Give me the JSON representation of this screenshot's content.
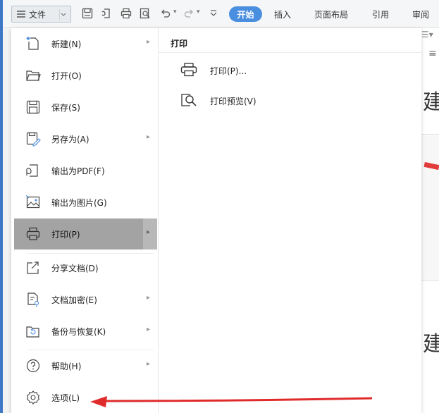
{
  "toolbar": {
    "file_label": "文件",
    "start_tab": "开始",
    "tabs": [
      "插入",
      "页面布局",
      "引用",
      "审阅"
    ]
  },
  "menu": {
    "items": [
      {
        "label": "新建(N)",
        "icon": "new-document-icon",
        "has_submenu": true
      },
      {
        "label": "打开(O)",
        "icon": "open-folder-icon",
        "has_submenu": false
      },
      {
        "label": "保存(S)",
        "icon": "save-icon",
        "has_submenu": false
      },
      {
        "label": "另存为(A)",
        "icon": "save-as-icon",
        "has_submenu": true
      },
      {
        "label": "输出为PDF(F)",
        "icon": "export-pdf-icon",
        "has_submenu": false
      },
      {
        "label": "输出为图片(G)",
        "icon": "export-image-icon",
        "has_submenu": false
      },
      {
        "label": "打印(P)",
        "icon": "print-icon",
        "has_submenu": true,
        "active": true
      },
      {
        "label": "分享文档(D)",
        "icon": "share-icon",
        "has_submenu": false
      },
      {
        "label": "文档加密(E)",
        "icon": "encrypt-icon",
        "has_submenu": true
      },
      {
        "label": "备份与恢复(K)",
        "icon": "backup-icon",
        "has_submenu": true
      },
      {
        "label": "帮助(H)",
        "icon": "help-icon",
        "has_submenu": true
      },
      {
        "label": "选项(L)",
        "icon": "gear-icon",
        "has_submenu": false
      }
    ]
  },
  "submenu": {
    "title": "打印",
    "items": [
      {
        "label": "打印(P)...",
        "icon": "print-icon"
      },
      {
        "label": "打印预览(V)",
        "icon": "print-preview-icon"
      }
    ]
  },
  "document": {
    "char_1": "建",
    "char_2": "建"
  },
  "colors": {
    "accent": "#4a8ee0",
    "active_row": "#a3a3a3",
    "annotation_arrow": "#e02b2b"
  }
}
